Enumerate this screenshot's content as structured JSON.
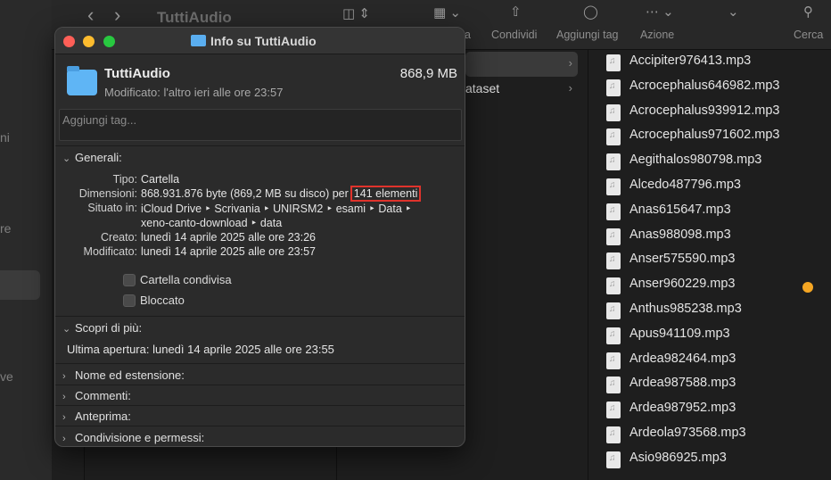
{
  "finder": {
    "title": "TuttiAudio",
    "sidebar_fragments": [
      "ni",
      "re",
      "ve"
    ],
    "toolbar": {
      "nav_back": "‹",
      "nav_forward": "›",
      "fragment_label": "pa",
      "share": "Condividi",
      "add_tag": "Aggiungi tag",
      "action": "Azione",
      "search": "Cerca"
    },
    "column3": [
      {
        "label": "",
        "selected": true
      },
      {
        "label": "ataset",
        "selected": false
      }
    ],
    "files": [
      {
        "name": "Accipiter976413.mp3",
        "tag": ""
      },
      {
        "name": "Acrocephalus646982.mp3",
        "tag": ""
      },
      {
        "name": "Acrocephalus939912.mp3",
        "tag": ""
      },
      {
        "name": "Acrocephalus971602.mp3",
        "tag": ""
      },
      {
        "name": "Aegithalos980798.mp3",
        "tag": ""
      },
      {
        "name": "Alcedo487796.mp3",
        "tag": ""
      },
      {
        "name": "Anas615647.mp3",
        "tag": ""
      },
      {
        "name": "Anas988098.mp3",
        "tag": ""
      },
      {
        "name": "Anser575590.mp3",
        "tag": ""
      },
      {
        "name": "Anser960229.mp3",
        "tag": "#f5a623"
      },
      {
        "name": "Anthus985238.mp3",
        "tag": ""
      },
      {
        "name": "Apus941109.mp3",
        "tag": ""
      },
      {
        "name": "Ardea982464.mp3",
        "tag": ""
      },
      {
        "name": "Ardea987588.mp3",
        "tag": ""
      },
      {
        "name": "Ardea987952.mp3",
        "tag": ""
      },
      {
        "name": "Ardeola973568.mp3",
        "tag": ""
      },
      {
        "name": "Asio986925.mp3",
        "tag": ""
      }
    ]
  },
  "info": {
    "window_title": "Info su TuttiAudio",
    "name": "TuttiAudio",
    "size": "868,9 MB",
    "modified_summary": "Modificato: l'altro ieri alle ore 23:57",
    "tags_placeholder": "Aggiungi tag...",
    "general": {
      "header": "Generali:",
      "tipo_label": "Tipo:",
      "tipo": "Cartella",
      "dim_label": "Dimensioni:",
      "dim_text": "868.931.876 byte (869,2 MB su disco) per",
      "dim_count": "141 elementi",
      "where_label": "Situato in:",
      "where_line1": "iCloud Drive ‣ Scrivania ‣ UNIRSM2 ‣ esami ‣ Data ‣",
      "where_line2": "xeno-canto-download ‣ data",
      "created_label": "Creato:",
      "created": "lunedì 14 aprile 2025 alle ore 23:26",
      "modified_label": "Modificato:",
      "modified": "lunedì 14 aprile 2025 alle ore 23:57",
      "shared_folder": "Cartella condivisa",
      "locked": "Bloccato"
    },
    "more": {
      "header": "Scopri di più:",
      "last_opened": "Ultima apertura: lunedì 14 aprile 2025 alle ore 23:55"
    },
    "collapsed_sections": [
      "Nome ed estensione:",
      "Commenti:",
      "Anteprima:",
      "Condivisione e permessi:"
    ],
    "traffic_lights": {
      "close": "#ff5f57",
      "minimize": "#febc2e",
      "zoom": "#28c840"
    }
  }
}
